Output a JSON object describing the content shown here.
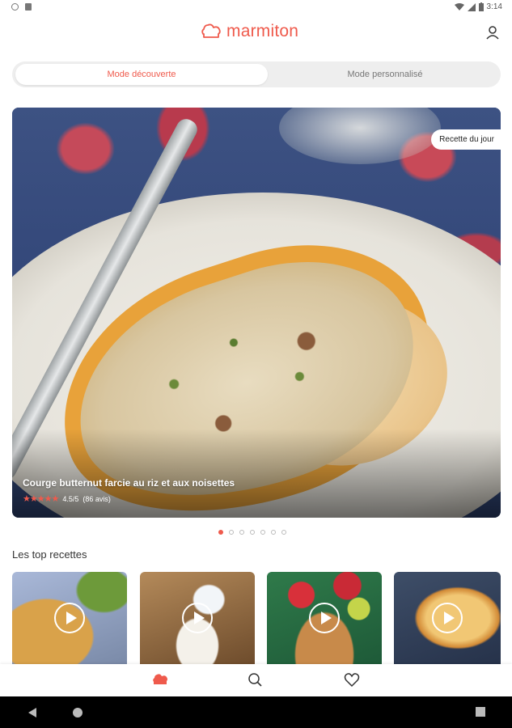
{
  "status_bar": {
    "time": "3:14"
  },
  "header": {
    "logo_text": "marmiton"
  },
  "mode_toggle": {
    "active_label": "Mode découverte",
    "inactive_label": "Mode personnalisé"
  },
  "hero": {
    "badge": "Recette du jour",
    "title": "Courge butternut farcie au riz et aux noisettes",
    "rating": "4.5/5",
    "reviews": "(86 avis)",
    "stars_display": "★★★★★",
    "pager": {
      "count": 7,
      "active_index": 0
    }
  },
  "top_recipes": {
    "title": "Les top recettes",
    "cards": [
      {
        "name": "top-recipe-1"
      },
      {
        "name": "top-recipe-2"
      },
      {
        "name": "top-recipe-3"
      },
      {
        "name": "top-recipe-4"
      }
    ]
  },
  "bottom_nav": {
    "items": [
      "home-icon",
      "search-icon",
      "favorites-icon"
    ]
  },
  "colors": {
    "accent": "#ef5a4c"
  }
}
